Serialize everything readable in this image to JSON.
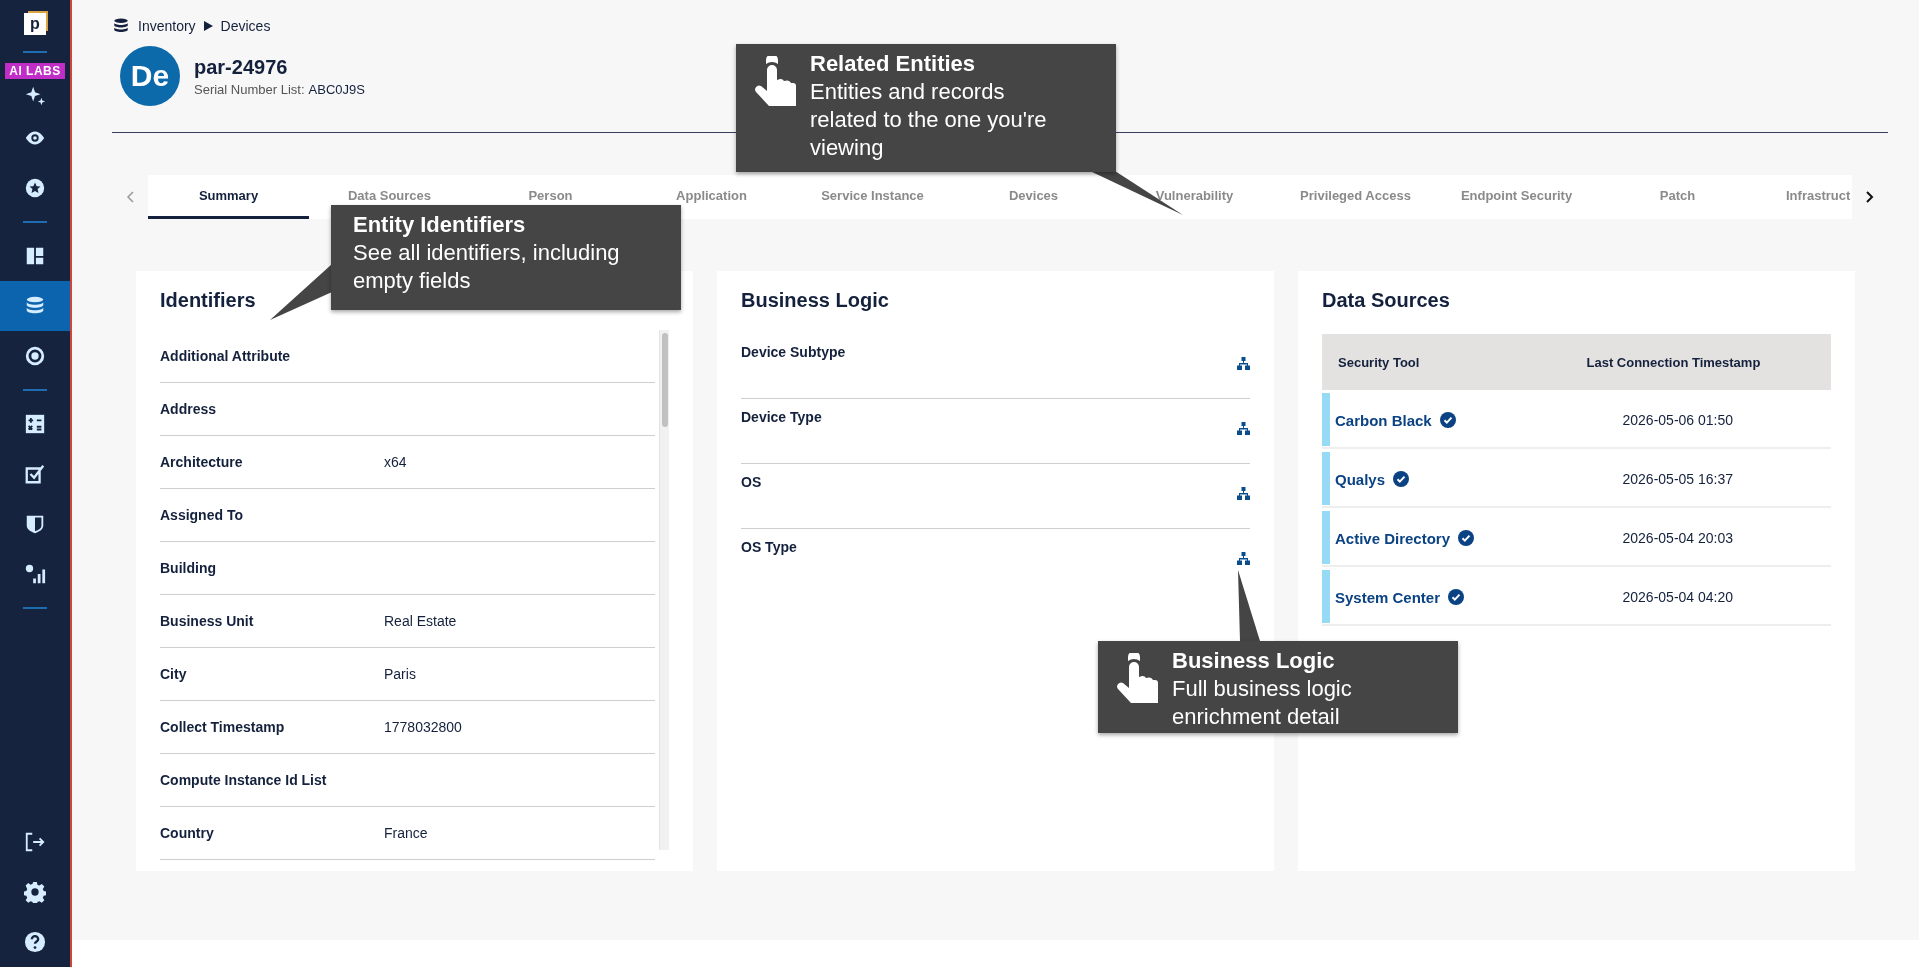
{
  "sidebar": {
    "logo": "p",
    "badge": "AI LABS",
    "items": [
      {
        "selected": false
      },
      {
        "selected": false
      },
      {
        "selected": false
      },
      {
        "selected": false
      },
      {
        "selected": true
      },
      {
        "selected": false
      },
      {
        "selected": false
      },
      {
        "selected": false
      },
      {
        "selected": false
      },
      {
        "selected": false
      }
    ],
    "bottom_items": [
      {
        "selected": false
      },
      {
        "selected": false
      },
      {
        "selected": false
      }
    ]
  },
  "breadcrumb": [
    "Inventory",
    "Devices"
  ],
  "entity": {
    "avatar": "De",
    "name": "par-24976",
    "subtitle_label": "Serial Number List:",
    "subtitle_value": "ABC0J9S"
  },
  "tabs": [
    {
      "label": "Summary",
      "selected": true
    },
    {
      "label": "Data Sources",
      "selected": false
    },
    {
      "label": "Person",
      "selected": false
    },
    {
      "label": "Application",
      "selected": false
    },
    {
      "label": "Service Instance",
      "selected": false
    },
    {
      "label": "Devices",
      "selected": false
    },
    {
      "label": "Vulnerability",
      "selected": false
    },
    {
      "label": "Privileged Access",
      "selected": false
    },
    {
      "label": "Endpoint Security",
      "selected": false
    },
    {
      "label": "Patch",
      "selected": false
    },
    {
      "label": "Infrastruct",
      "selected": false
    }
  ],
  "identifiers": {
    "title": "Identifiers",
    "rows": [
      {
        "label": "Additional Attribute"
      },
      {
        "label": "Address"
      },
      {
        "label": "Architecture",
        "value": "x64"
      },
      {
        "label": "Assigned To"
      },
      {
        "label": "Building"
      },
      {
        "label": "Business Unit",
        "value": "Real Estate"
      },
      {
        "label": "City",
        "value": "Paris"
      },
      {
        "label": "Collect Timestamp",
        "value": "1778032800"
      },
      {
        "label": "Compute Instance Id List"
      },
      {
        "label": "Country",
        "value": "France"
      }
    ]
  },
  "business_logic": {
    "title": "Business Logic",
    "rows": [
      "Device Subtype",
      "Device Type",
      "OS",
      "OS Type"
    ]
  },
  "data_sources": {
    "title": "Data Sources",
    "columns": [
      "Security Tool",
      "Last Connection Timestamp"
    ],
    "rows": [
      {
        "tool": "Carbon Black",
        "timestamp": "2026-05-06 01:50"
      },
      {
        "tool": "Qualys",
        "timestamp": "2026-05-05 16:37"
      },
      {
        "tool": "Active Directory",
        "timestamp": "2026-05-04 20:03"
      },
      {
        "tool": "System Center",
        "timestamp": "2026-05-04 04:20"
      }
    ]
  },
  "callouts": [
    {
      "title": "Related Entities",
      "text": "Entities and records related to the one you're viewing",
      "hand": true
    },
    {
      "title": "Entity Identifiers",
      "text": "See all identifiers, including empty fields",
      "hand": false
    },
    {
      "title": "Business Logic",
      "text": "Full business logic enrichment detail",
      "hand": true
    }
  ]
}
